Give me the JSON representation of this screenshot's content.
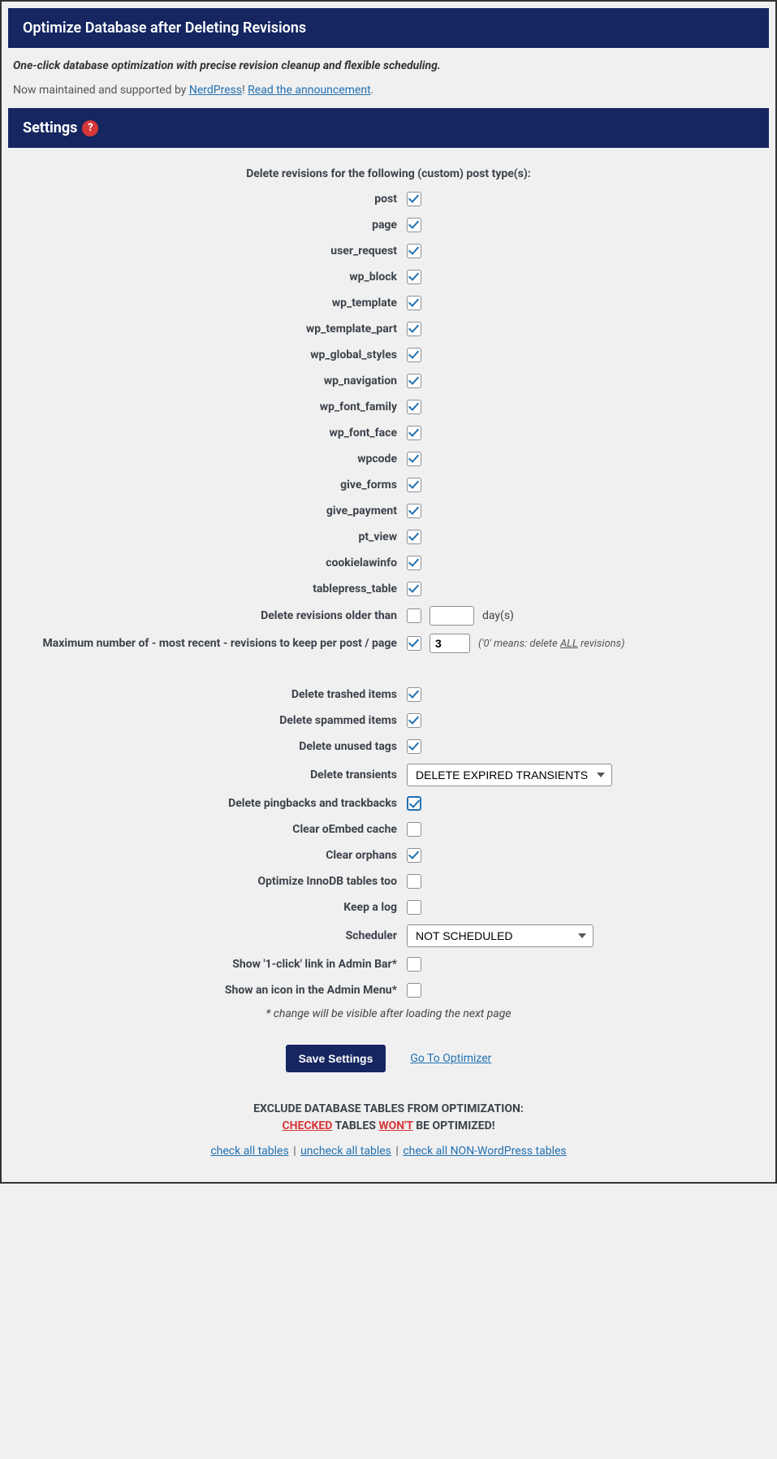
{
  "header": {
    "title": "Optimize Database after Deleting Revisions"
  },
  "intro": {
    "tagline": "One-click database optimization with precise revision cleanup and flexible scheduling.",
    "maintained_pre": "Now maintained and supported by ",
    "nerdpress": "NerdPress",
    "exclaim": "! ",
    "announcement": "Read the announcement",
    "period": "."
  },
  "settings": {
    "title": "Settings"
  },
  "post_types_heading": "Delete revisions for the following (custom) post type(s):",
  "post_types": [
    {
      "label": "post",
      "checked": true
    },
    {
      "label": "page",
      "checked": true
    },
    {
      "label": "user_request",
      "checked": true
    },
    {
      "label": "wp_block",
      "checked": true
    },
    {
      "label": "wp_template",
      "checked": true
    },
    {
      "label": "wp_template_part",
      "checked": true
    },
    {
      "label": "wp_global_styles",
      "checked": true
    },
    {
      "label": "wp_navigation",
      "checked": true
    },
    {
      "label": "wp_font_family",
      "checked": true
    },
    {
      "label": "wp_font_face",
      "checked": true
    },
    {
      "label": "wpcode",
      "checked": true
    },
    {
      "label": "give_forms",
      "checked": true
    },
    {
      "label": "give_payment",
      "checked": true
    },
    {
      "label": "pt_view",
      "checked": true
    },
    {
      "label": "cookielawinfo",
      "checked": true
    },
    {
      "label": "tablepress_table",
      "checked": true
    }
  ],
  "older_than": {
    "label": "Delete revisions older than",
    "checked": false,
    "value": "",
    "suffix": "day(s)"
  },
  "max_revisions": {
    "label": "Maximum number of - most recent - revisions to keep per post / page",
    "checked": true,
    "value": "3",
    "hint_pre": "('0' means: delete ",
    "hint_all": "ALL",
    "hint_post": " revisions)"
  },
  "options": {
    "delete_trashed": {
      "label": "Delete trashed items",
      "checked": true
    },
    "delete_spammed": {
      "label": "Delete spammed items",
      "checked": true
    },
    "delete_unused_tags": {
      "label": "Delete unused tags",
      "checked": true
    },
    "delete_transients": {
      "label": "Delete transients",
      "selected": "DELETE EXPIRED TRANSIENTS"
    },
    "delete_pingbacks": {
      "label": "Delete pingbacks and trackbacks",
      "checked": true
    },
    "clear_oembed": {
      "label": "Clear oEmbed cache",
      "checked": false
    },
    "clear_orphans": {
      "label": "Clear orphans",
      "checked": true
    },
    "optimize_innodb": {
      "label": "Optimize InnoDB tables too",
      "checked": false
    },
    "keep_log": {
      "label": "Keep a log",
      "checked": false
    },
    "scheduler": {
      "label": "Scheduler",
      "selected": "NOT SCHEDULED"
    },
    "show_1click": {
      "label": "Show '1-click' link in Admin Bar*",
      "checked": false
    },
    "show_icon": {
      "label": "Show an icon in the Admin Menu*",
      "checked": false
    }
  },
  "asterisk_note": "* change will be visible after loading the next page",
  "buttons": {
    "save": "Save Settings",
    "goto": "Go To Optimizer"
  },
  "exclude": {
    "line1": "EXCLUDE DATABASE TABLES FROM OPTIMIZATION:",
    "checked_word": "CHECKED",
    "tables_word": " TABLES ",
    "wont_word": "WON'T",
    "rest": " BE OPTIMIZED!"
  },
  "table_links": {
    "check_all": "check all tables",
    "uncheck_all": "uncheck all tables",
    "check_nonwp": "check all NON-WordPress tables"
  }
}
